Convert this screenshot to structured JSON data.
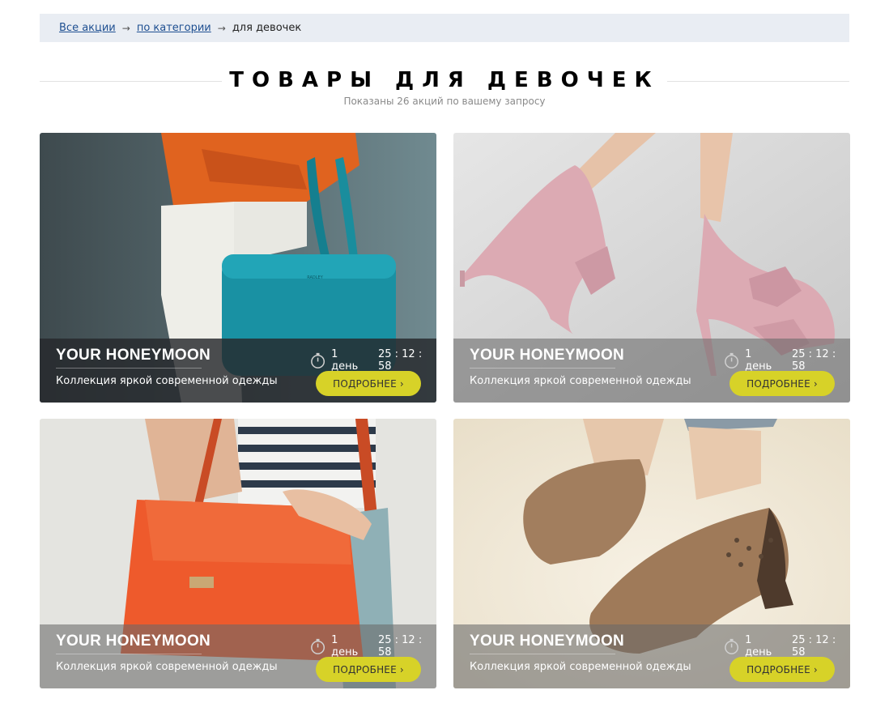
{
  "breadcrumb": {
    "items": [
      {
        "label": "Все акции",
        "link": true
      },
      {
        "label": "по категории",
        "link": true
      },
      {
        "label": "для девочек",
        "link": false
      }
    ],
    "separator": "→"
  },
  "heading": {
    "title": "ТОВАРЫ ДЛЯ ДЕВОЧЕК",
    "subtitle": "Показаны 26 акций по вашему запросу"
  },
  "cards": [
    {
      "title": "YOUR HONEYMOON",
      "description": "Коллекция яркой современной одежды",
      "days": "1 день",
      "time": "25 : 12 : 58",
      "button": "ПОДРОБНЕЕ ›",
      "image": "teal-handbag-photo"
    },
    {
      "title": "YOUR HONEYMOON",
      "description": "Коллекция яркой современной одежды",
      "days": "1 день",
      "time": "25 : 12 : 58",
      "button": "ПОДРОБНЕЕ ›",
      "image": "pink-heels-photo"
    },
    {
      "title": "YOUR HONEYMOON",
      "description": "Коллекция яркой современной одежды",
      "days": "1 день",
      "time": "25 : 12 : 58",
      "button": "ПОДРОБНЕЕ ›",
      "image": "orange-satchel-photo"
    },
    {
      "title": "YOUR HONEYMOON",
      "description": "Коллекция яркой современной одежды",
      "days": "1 день",
      "time": "25 : 12 : 58",
      "button": "ПОДРОБНЕЕ ›",
      "image": "brown-oxford-shoes-photo"
    }
  ],
  "colors": {
    "button": "#d7d228",
    "link": "#1e4f91",
    "breadcrumb_bg": "#e9edf3"
  },
  "icons": {
    "timer": "stopwatch-icon",
    "separator": "arrow-right-icon"
  }
}
